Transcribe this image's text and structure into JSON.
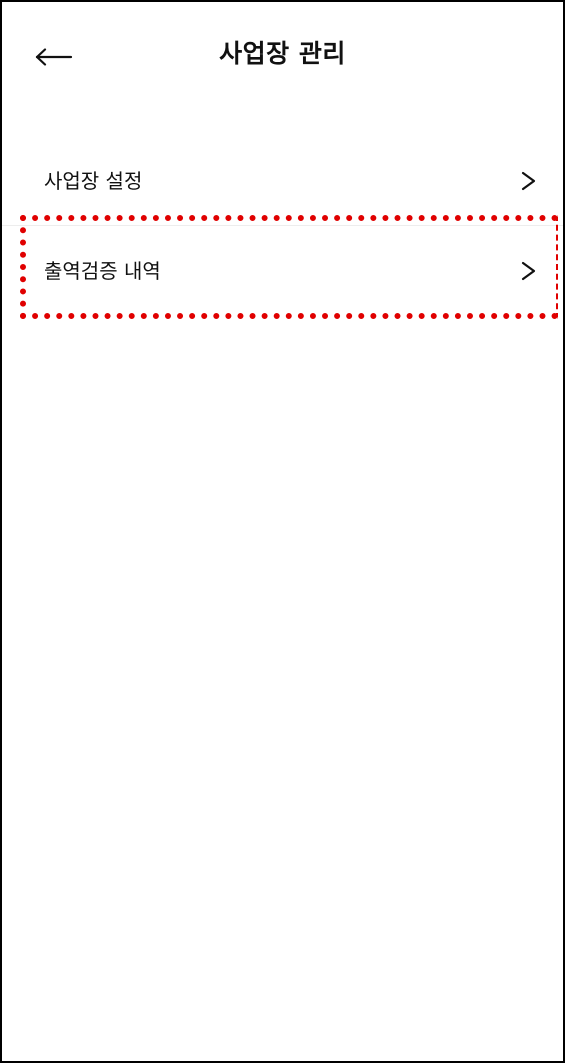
{
  "header": {
    "title": "사업장 관리",
    "back_icon": "left-arrow-icon"
  },
  "menu": {
    "items": [
      {
        "label": "사업장 설정",
        "icon": "chevron-right-icon"
      },
      {
        "label": "출역검증 내역",
        "icon": "chevron-right-icon"
      }
    ]
  },
  "colors": {
    "background": "#ffffff",
    "text": "#111111",
    "highlight": "#e00000",
    "divider": "#ededed"
  }
}
